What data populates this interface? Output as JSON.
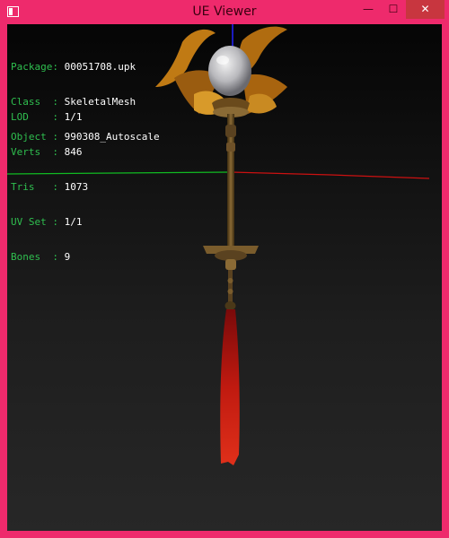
{
  "window": {
    "title": "UE Viewer"
  },
  "controls": {
    "minimize": "—",
    "maximize": "☐",
    "close": "✕"
  },
  "mesh_info": [
    {
      "key": "Package:",
      "value": "00051708.upk"
    },
    {
      "key": "Class  :",
      "value": "SkeletalMesh"
    },
    {
      "key": "Object :",
      "value": "990308_Autoscale"
    }
  ],
  "stats": [
    {
      "key": "LOD    :",
      "value": "1/1"
    },
    {
      "key": "Verts  :",
      "value": "846"
    },
    {
      "key": "Tris   :",
      "value": "1073"
    },
    {
      "key": "UV Set :",
      "value": "1/1"
    },
    {
      "key": "Bones  :",
      "value": "9"
    }
  ],
  "colors": {
    "frame": "#ee2a6c",
    "label": "#2fbf4f",
    "value": "#ffffff",
    "axis_x": "#cc1111",
    "axis_z": "#2222ff",
    "axis_y": "#11bb22"
  }
}
